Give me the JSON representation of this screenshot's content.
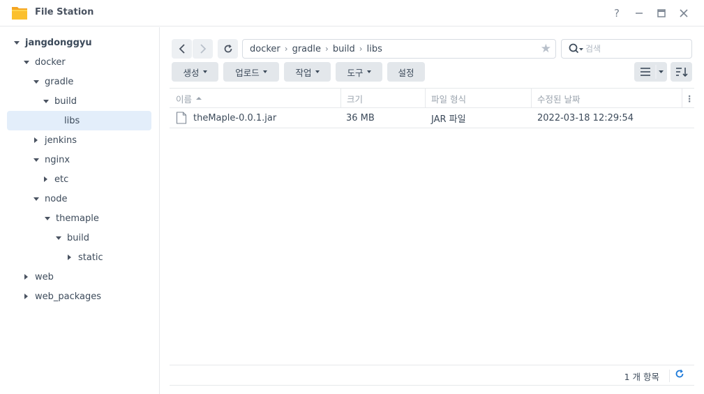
{
  "window": {
    "title": "File Station",
    "help_icon": "help-icon",
    "minimize_icon": "minimize-icon",
    "maximize_icon": "maximize-icon",
    "close_icon": "close-icon"
  },
  "tree": {
    "root": "jangdonggyu",
    "items": [
      {
        "label": "docker"
      },
      {
        "label": "gradle"
      },
      {
        "label": "build"
      },
      {
        "label": "libs"
      },
      {
        "label": "jenkins"
      },
      {
        "label": "nginx"
      },
      {
        "label": "etc"
      },
      {
        "label": "node"
      },
      {
        "label": "themaple"
      },
      {
        "label": "build"
      },
      {
        "label": "static"
      },
      {
        "label": "web"
      },
      {
        "label": "web_packages"
      }
    ]
  },
  "path": [
    "docker",
    "gradle",
    "build",
    "libs"
  ],
  "search": {
    "placeholder": "검색"
  },
  "toolbar": {
    "create": "생성",
    "upload": "업로드",
    "action": "작업",
    "tools": "도구",
    "settings": "설정"
  },
  "columns": {
    "name": "이름",
    "size": "크기",
    "type": "파일 형식",
    "modified": "수정된 날짜"
  },
  "files": [
    {
      "name": "theMaple-0.0.1.jar",
      "size": "36 MB",
      "type": "JAR 파일",
      "modified": "2022-03-18 12:29:54"
    }
  ],
  "footer": {
    "count": "1 개 항목"
  },
  "colors": {
    "accent": "#1d7ad9",
    "selected": "#e3eefa"
  }
}
